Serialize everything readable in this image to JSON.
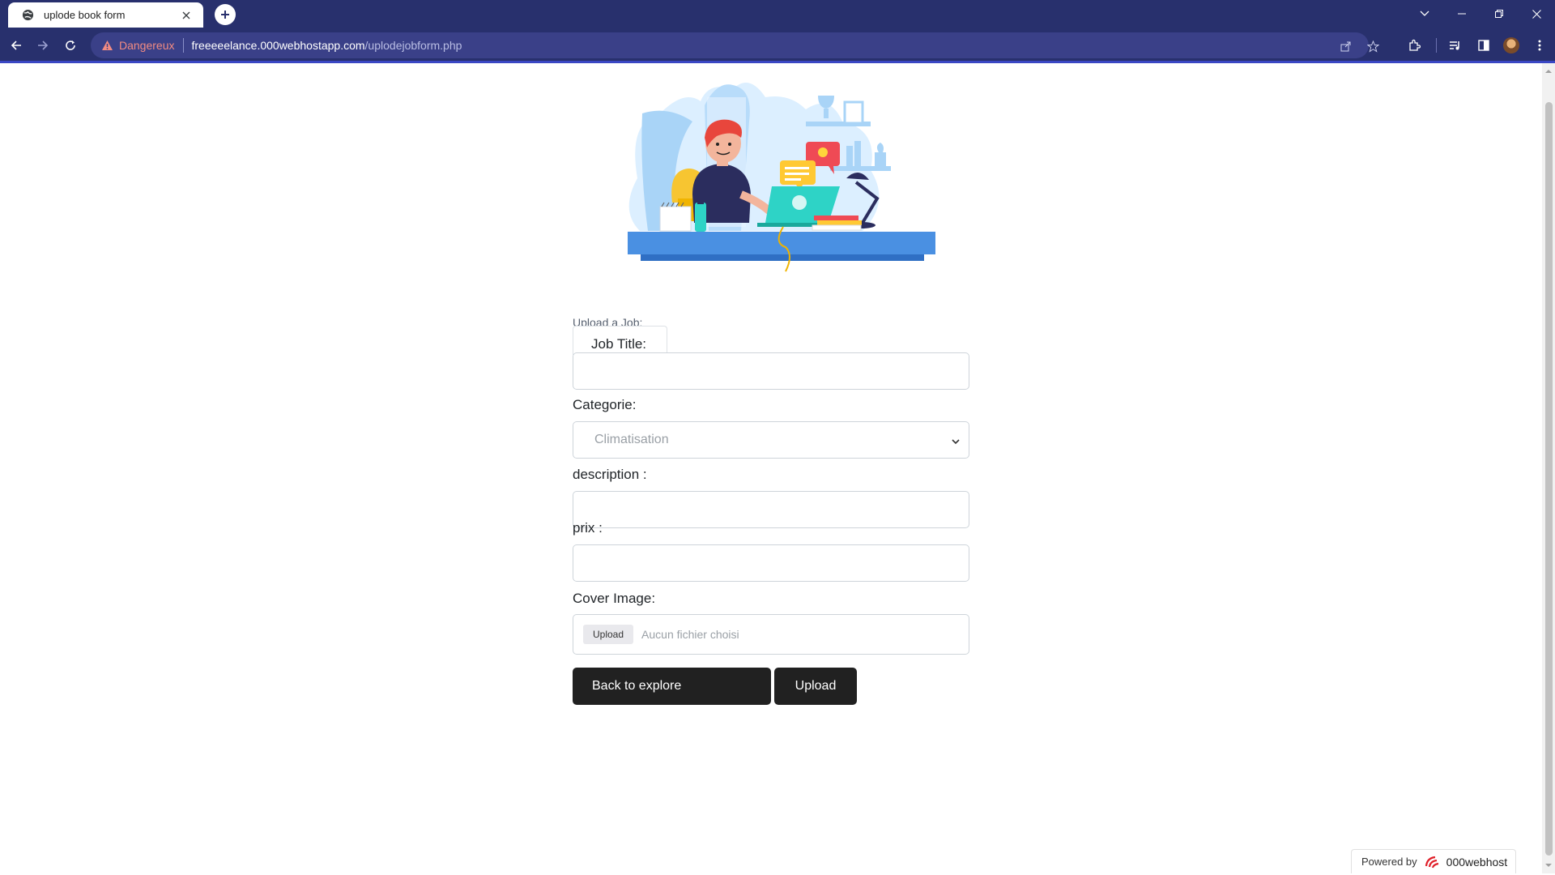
{
  "browser": {
    "tab_title": "uplode book form",
    "security_label": "Dangereux",
    "url_host": "freeeeelance.000webhostapp.com",
    "url_path": "/uplodejobform.php"
  },
  "form": {
    "legend": "Upload a Job:",
    "job_title_label": "Job Title:",
    "job_title_value": "",
    "categorie_label": "Categorie:",
    "categorie_selected": "Climatisation",
    "description_label": "description :",
    "description_value": "",
    "prix_label": "prix :",
    "prix_value": "",
    "cover_image_label": "Cover Image:",
    "file_button_label": "Upload",
    "file_status": "Aucun fichier choisi",
    "back_button_label": "Back to explore",
    "upload_button_label": "Upload"
  },
  "footer": {
    "powered_by": "Powered by",
    "brand": "000webhost"
  },
  "colors": {
    "chrome": "#28306d",
    "omnibox": "#3a4088",
    "danger": "#f28b82",
    "button_dark": "#212121"
  }
}
